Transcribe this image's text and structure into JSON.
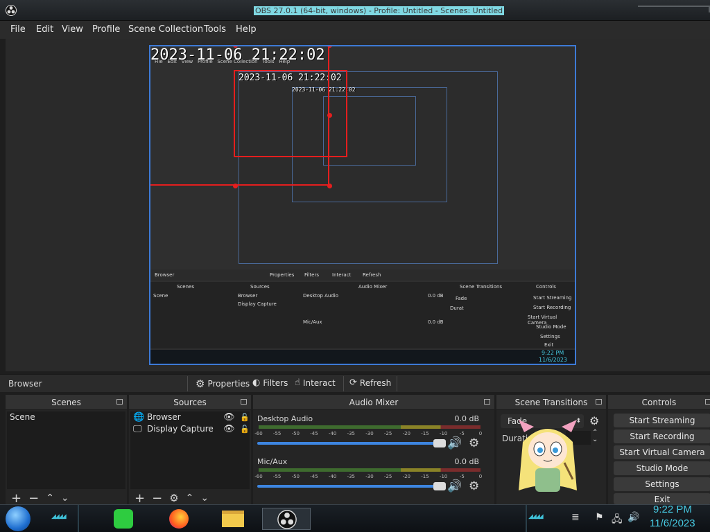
{
  "window": {
    "title": "OBS 27.0.1 (64-bit, windows) - Profile: Untitled - Scenes: Untitled"
  },
  "menu": [
    "File",
    "Edit",
    "View",
    "Profile",
    "Scene Collection",
    "Tools",
    "Help"
  ],
  "preview": {
    "clock_text": "2023-11-06 21:22:02",
    "nested_menu": [
      "File",
      "Edit",
      "View",
      "Profile",
      "Scene Collection",
      "Tools",
      "Help"
    ],
    "nested_source_label": "Browser",
    "nested_buttons": [
      "Properties",
      "Filters",
      "Interact",
      "Refresh"
    ],
    "nested_docks": [
      "Scenes",
      "Sources",
      "Audio Mixer",
      "Scene Transitions",
      "Controls"
    ],
    "nested_scene": "Scene",
    "nested_sources": [
      "Browser",
      "Display Capture"
    ],
    "nested_meters": [
      {
        "name": "Desktop Audio",
        "db": "0.0 dB"
      },
      {
        "name": "Mic/Aux",
        "db": "0.0 dB"
      }
    ],
    "nested_transition": "Fade",
    "nested_duration": "Durat",
    "nested_controls": [
      "Start Streaming",
      "Start Recording",
      "Start Virtual Camera",
      "Studio Mode",
      "Settings",
      "Exit"
    ],
    "nested_time": "9:22 PM",
    "nested_date": "11/6/2023"
  },
  "source_toolbar": {
    "selected_source": "Browser",
    "buttons": [
      "Properties",
      "Filters",
      "Interact",
      "Refresh"
    ]
  },
  "scenes": {
    "title": "Scenes",
    "items": [
      "Scene"
    ]
  },
  "sources": {
    "title": "Sources",
    "items": [
      {
        "name": "Browser",
        "icon": "globe-icon"
      },
      {
        "name": "Display Capture",
        "icon": "monitor-icon"
      }
    ]
  },
  "audio_mixer": {
    "title": "Audio Mixer",
    "ticks": [
      "-60",
      "-55",
      "-50",
      "-45",
      "-40",
      "-35",
      "-30",
      "-25",
      "-20",
      "-15",
      "-10",
      "-5",
      "0"
    ],
    "channels": [
      {
        "name": "Desktop Audio",
        "db": "0.0 dB",
        "volume": 1.0
      },
      {
        "name": "Mic/Aux",
        "db": "0.0 dB",
        "volume": 1.0
      }
    ]
  },
  "scene_transitions": {
    "title": "Scene Transitions",
    "transition": "Fade",
    "duration_label": "Durati"
  },
  "controls": {
    "title": "Controls",
    "buttons": [
      "Start Streaming",
      "Start Recording",
      "Start Virtual Camera",
      "Studio Mode",
      "Settings",
      "Exit"
    ]
  },
  "taskbar": {
    "time": "9:22 PM",
    "date": "11/6/2023"
  },
  "colors": {
    "accent": "#3d7ad6",
    "selection": "#e51e1e",
    "clock": "#46c8e0"
  }
}
